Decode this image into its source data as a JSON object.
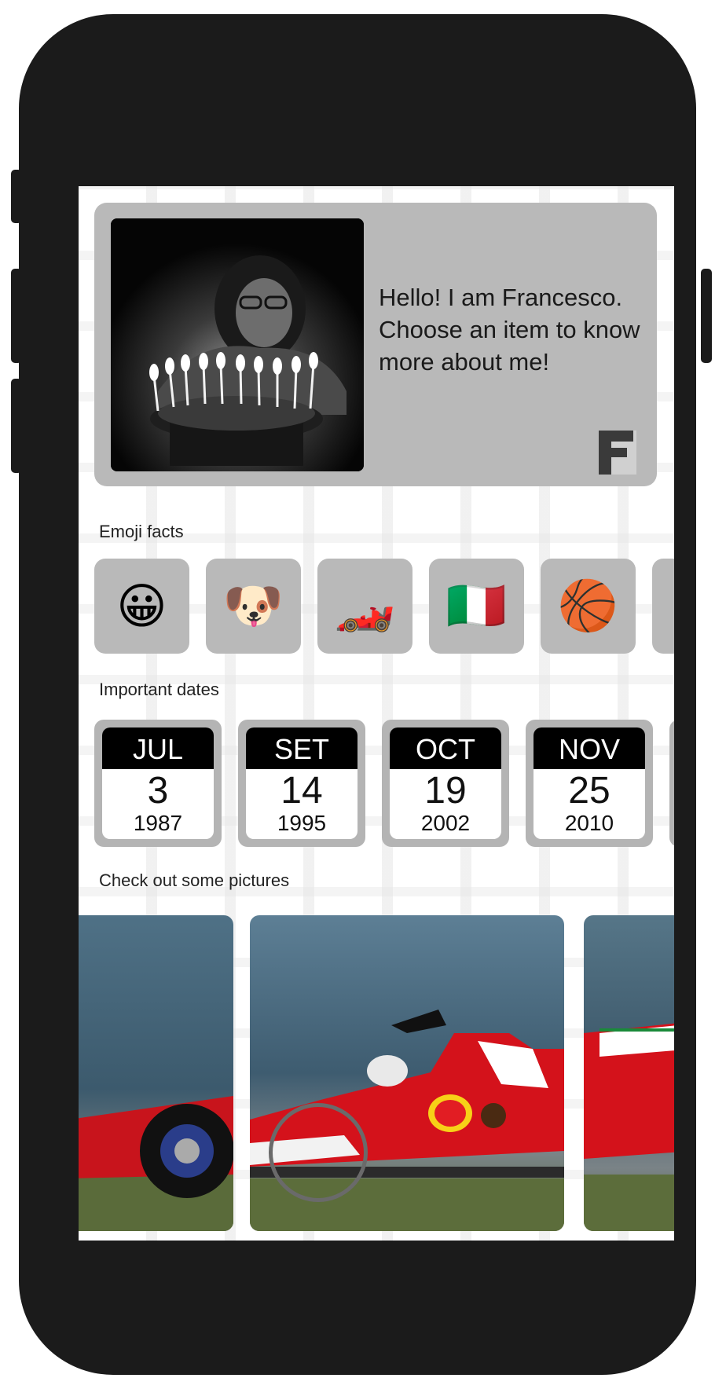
{
  "hero": {
    "intro_text": "Hello! I am Francesco. Choose an item to know more about me!",
    "photo_icon": "profile-photo-birthday-cake",
    "logo_icon": "f-logo"
  },
  "sections": {
    "emoji_label": "Emoji facts",
    "dates_label": "Important dates",
    "pictures_label": "Check out some pictures"
  },
  "emoji_facts": [
    {
      "emoji": "😀",
      "icon": "grinning-face-icon"
    },
    {
      "emoji": "🐶",
      "icon": "dog-face-icon"
    },
    {
      "emoji": "🏎️",
      "icon": "racing-car-icon"
    },
    {
      "emoji": "🇮🇹",
      "icon": "italy-flag-icon"
    },
    {
      "emoji": "🏀",
      "icon": "basketball-icon"
    }
  ],
  "dates": [
    {
      "month": "JUL",
      "day": "3",
      "year": "1987"
    },
    {
      "month": "SET",
      "day": "14",
      "year": "1995"
    },
    {
      "month": "OCT",
      "day": "19",
      "year": "2002"
    },
    {
      "month": "NOV",
      "day": "25",
      "year": "2010"
    }
  ],
  "pictures": [
    {
      "icon": "ferrari-f1-car-photo"
    },
    {
      "icon": "ferrari-f1-car-photo"
    },
    {
      "icon": "ferrari-f1-car-photo"
    }
  ],
  "colors": {
    "card_gray": "#b9b9b9",
    "frame": "#1b1b1b",
    "ferrari_red": "#d4121b"
  }
}
